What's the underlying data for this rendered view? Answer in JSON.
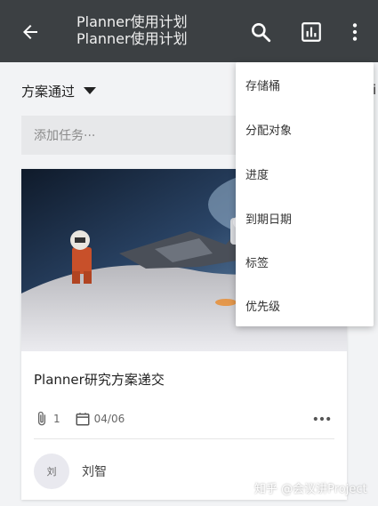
{
  "header": {
    "title_line1": "Planner使用计划",
    "title_line2": "Planner使用计划",
    "back_icon": "arrow-left-icon",
    "search_icon": "search-icon",
    "chart_icon": "bar-chart-icon",
    "more_icon": "more-vertical-icon"
  },
  "board": {
    "bucket_label": "方案通过",
    "add_task_placeholder": "添加任务···"
  },
  "card": {
    "title": "Planner研究方案递交",
    "attachment_count": "1",
    "due_date": "04/06",
    "assignee_initial": "刘",
    "assignee_name": "刘智"
  },
  "menu": {
    "items": [
      "存储桶",
      "分配对象",
      "进度",
      "到期日期",
      "标签",
      "优先级"
    ]
  },
  "watermark": "知乎 @会议讲Project",
  "colors": {
    "header_bg": "#3c4043",
    "page_bg": "#f2f3f5"
  }
}
